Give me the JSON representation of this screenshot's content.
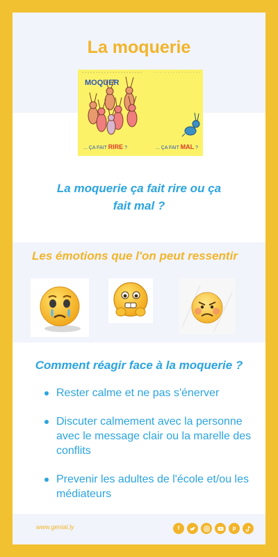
{
  "title": "La moquerie",
  "hero": {
    "text_left": "MOQUER",
    "caption_left_prefix": "... ÇA FAIT ",
    "caption_left_word": "RIRE",
    "caption_left_suffix": " ?",
    "caption_right_prefix": "... ÇA FAIT ",
    "caption_right_word": "MAL",
    "caption_right_suffix": " ?"
  },
  "question": "La moquerie ça fait rire ou ça fait mal ?",
  "emotions_title": "Les émotions que l'on peut ressentir",
  "emotions": [
    "crying-face-icon",
    "fearful-face-icon",
    "angry-face-icon"
  ],
  "how_title": "Comment réagir face à la moquerie ?",
  "tips": [
    "Rester calme et ne pas s'énerver",
    "Discuter calmement avec la personne avec le message clair ou la marelle des conflits",
    "Prevenir les adultes de l'école et/ou les médiateurs"
  ],
  "footer": {
    "link": "www.genial.ly",
    "socials": [
      "facebook-icon",
      "twitter-icon",
      "instagram-icon",
      "youtube-icon",
      "pinterest-icon",
      "tiktok-icon"
    ]
  },
  "colors": {
    "border": "#f2c131",
    "accent_yellow": "#f2b429",
    "accent_blue": "#2ba4df",
    "band": "#f1f4fb"
  }
}
